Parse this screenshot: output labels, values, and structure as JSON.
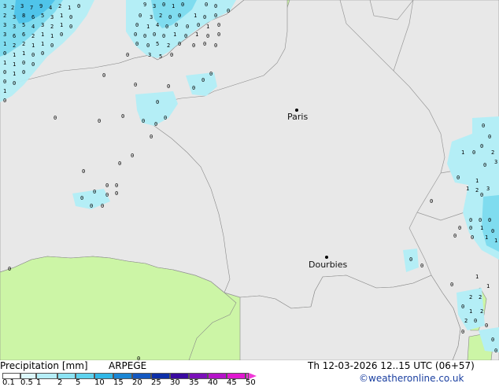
{
  "map": {
    "cities": [
      {
        "name": "Paris"
      },
      {
        "name": "Dourbies"
      }
    ]
  },
  "footer": {
    "title": "Precipitation [mm]",
    "model": "ARPEGE",
    "datetime": "Th 12-03-2026 12..15 UTC (06+57)",
    "credit": "©weatheronline.co.uk",
    "scale_labels": [
      "0.1",
      "0.5",
      "1",
      "2",
      "5",
      "10",
      "15",
      "20",
      "25",
      "30",
      "35",
      "40",
      "45",
      "50"
    ],
    "scale_colors": [
      "#ffffff",
      "#dcf7fb",
      "#b6eef7",
      "#8ce3f3",
      "#5ed2ee",
      "#30b7e6",
      "#1a86d4",
      "#1458c0",
      "#0d2fa8",
      "#3a0aa0",
      "#7a10b8",
      "#b414c8",
      "#e018d0",
      "#f03ad8"
    ]
  },
  "colors": {
    "sea": "#e8e8e8",
    "land": "#ccf5a6",
    "precip_light": "#b4eef6",
    "precip_medium": "#7fdcef",
    "precip_heavy": "#4fc4ea",
    "border": "#aaaaaa"
  }
}
